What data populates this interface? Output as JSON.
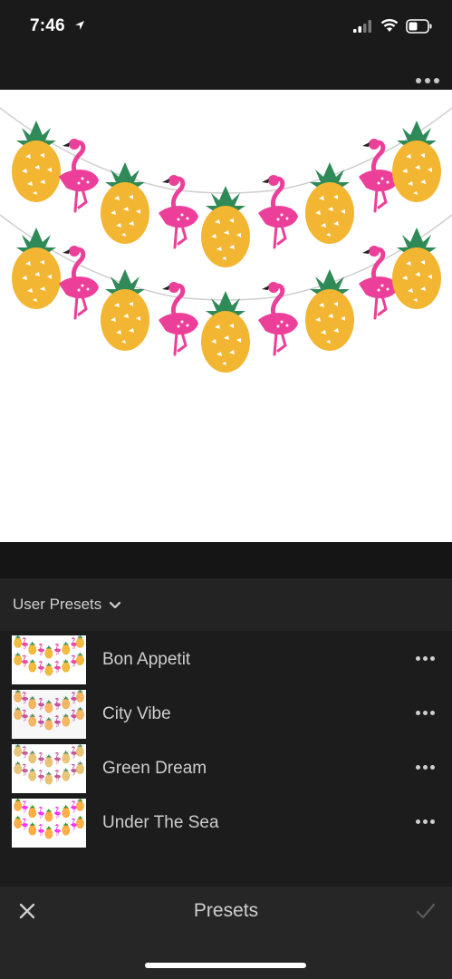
{
  "status_bar": {
    "time": "7:46"
  },
  "photo": {
    "subject": "flamingo-pineapple-garland"
  },
  "presets": {
    "group_label": "User Presets",
    "items": [
      {
        "name": "Bon Appetit"
      },
      {
        "name": "City Vibe"
      },
      {
        "name": "Green Dream"
      },
      {
        "name": "Under The Sea"
      }
    ]
  },
  "bottom_bar": {
    "title": "Presets"
  },
  "colors": {
    "background": "#1a1a1a",
    "pineapple": "#f2b632",
    "leaf": "#2f8a57",
    "flamingo": "#ec3f99"
  }
}
